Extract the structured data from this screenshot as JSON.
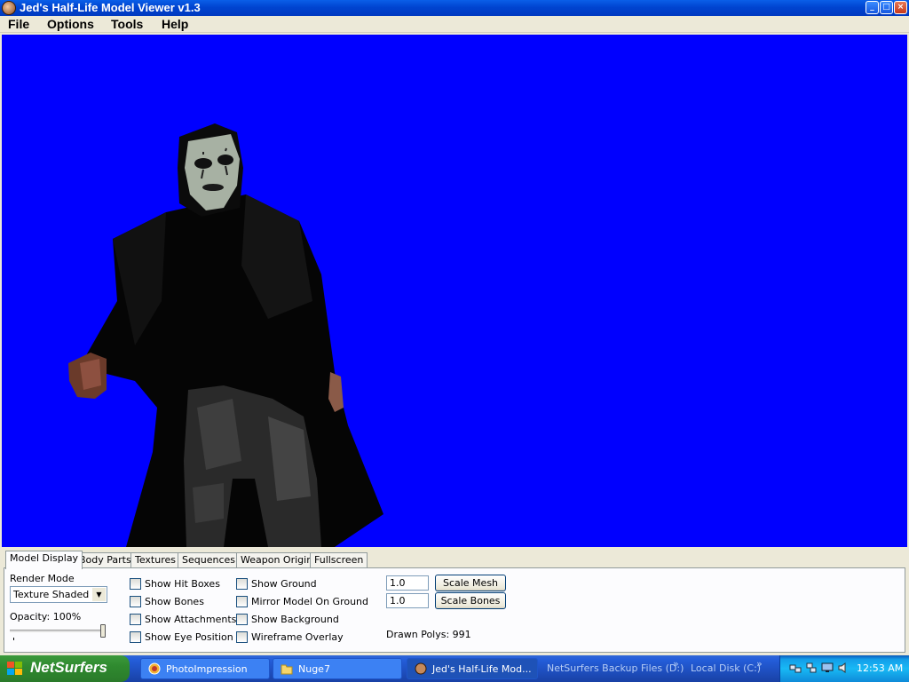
{
  "window": {
    "title": "Jed's Half-Life Model Viewer v1.3",
    "controls": [
      "_",
      "□",
      "×"
    ]
  },
  "menu": [
    "File",
    "Options",
    "Tools",
    "Help"
  ],
  "viewport": {
    "background_color": "#0000ff"
  },
  "tabs": [
    "Model Display",
    "Body Parts",
    "Textures",
    "Sequences",
    "Weapon Origin",
    "Fullscreen"
  ],
  "active_tab": "Model Display",
  "model_display": {
    "render_mode_label": "Render Mode",
    "render_mode_value": "Texture Shaded",
    "opacity_label": "Opacity: 100%",
    "opacity_level": 1.0,
    "checkboxes_left": [
      "Show Hit Boxes",
      "Show Bones",
      "Show Attachments",
      "Show Eye Position"
    ],
    "checkboxes_mid": [
      "Show Ground",
      "Mirror Model On Ground",
      "Show Background",
      "Wireframe Overlay"
    ],
    "scale_mesh_value": "1.0",
    "scale_bones_value": "1.0",
    "scale_mesh_label": "Scale Mesh",
    "scale_bones_label": "Scale Bones",
    "drawn_polys": "Drawn Polys: 991"
  },
  "taskbar": {
    "start_label": "NetSurfers",
    "tasks": [
      "PhotoImpression",
      "Nuge7",
      "Jed's Half-Life Mod..."
    ],
    "active_task": "Jed's Half-Life Mod...",
    "quick": [
      "NetSurfers Backup Files (D:)",
      "»",
      "Local Disk (C:)",
      "»"
    ],
    "clock": "12:53 AM"
  }
}
